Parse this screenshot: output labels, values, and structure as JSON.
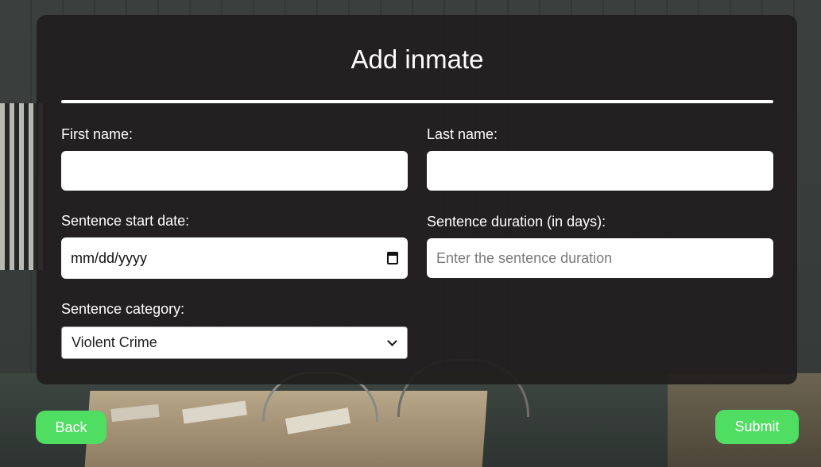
{
  "form": {
    "title": "Add inmate",
    "first_name": {
      "label": "First name:",
      "value": ""
    },
    "last_name": {
      "label": "Last name:",
      "value": ""
    },
    "start_date": {
      "label": "Sentence start date:",
      "value": "mm/dd/yyyy"
    },
    "duration": {
      "label": "Sentence duration (in days):",
      "placeholder": "Enter the sentence duration",
      "value": ""
    },
    "category": {
      "label": "Sentence category:",
      "selected": "Violent Crime"
    }
  },
  "actions": {
    "back_label": "Back",
    "submit_label": "Submit"
  },
  "colors": {
    "accent": "#4fdd62",
    "panel": "#201e1e"
  },
  "icons": {
    "date_picker": "calendar-icon",
    "select": "chevron-down-icon"
  }
}
